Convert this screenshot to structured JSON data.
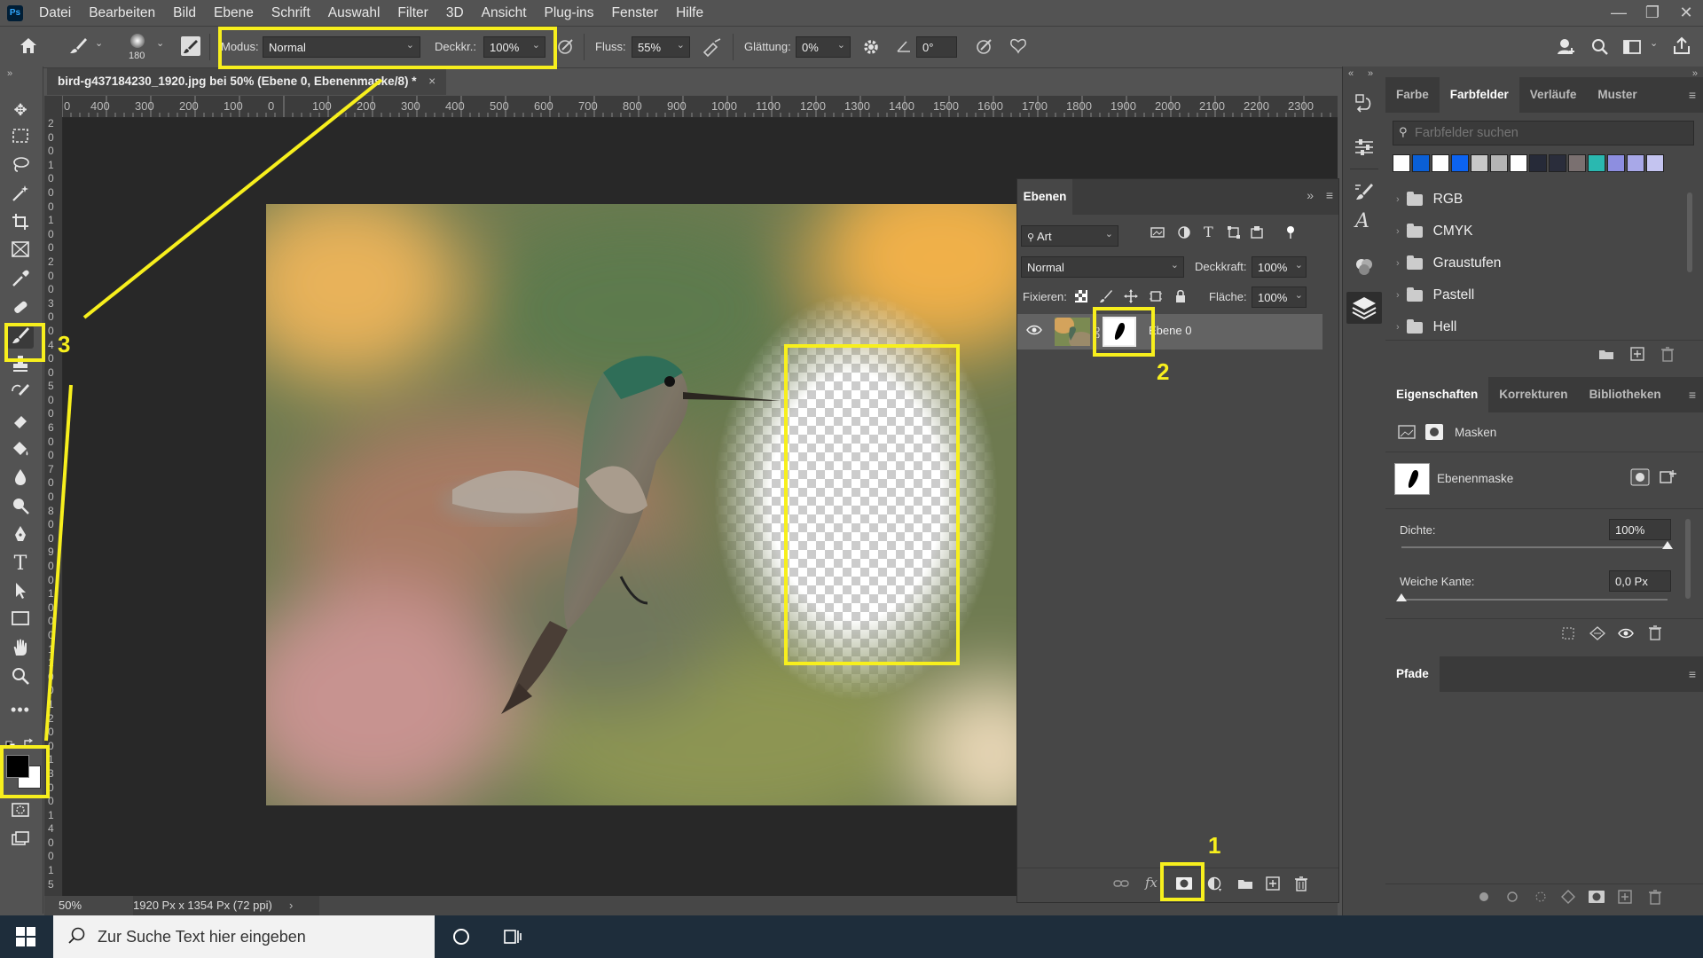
{
  "app": {
    "logo": "Ps"
  },
  "menu": [
    "Datei",
    "Bearbeiten",
    "Bild",
    "Ebene",
    "Schrift",
    "Auswahl",
    "Filter",
    "3D",
    "Ansicht",
    "Plug-ins",
    "Fenster",
    "Hilfe"
  ],
  "window_controls": {
    "minimize": "—",
    "restore": "❐",
    "close": "✕"
  },
  "options": {
    "brush_size": "180",
    "mode_label": "Modus:",
    "mode_value": "Normal",
    "opacity_label": "Deckkr.:",
    "opacity_value": "100%",
    "flow_label": "Fluss:",
    "flow_value": "55%",
    "smoothing_label": "Glättung:",
    "smoothing_value": "0%",
    "angle_value": "0°"
  },
  "document": {
    "tab_title": "bird-g437184230_1920.jpg bei 50% (Ebene 0, Ebenenmaske/8) *",
    "close": "×",
    "zoom": "50%",
    "size_info": "1920 Px x 1354 Px (72 ppi)",
    "ruler_h": [
      "0",
      "400",
      "300",
      "200",
      "100",
      "0",
      "100",
      "200",
      "300",
      "400",
      "500",
      "600",
      "700",
      "800",
      "900",
      "1000",
      "1100",
      "1200",
      "1300",
      "1400",
      "1500",
      "1600",
      "1700",
      "1800",
      "1900",
      "2000",
      "2100",
      "2200",
      "2300"
    ],
    "ruler_v": [
      "2",
      "0",
      "0",
      "1",
      "0",
      "0",
      "0",
      "1",
      "0",
      "0",
      "2",
      "0",
      "0",
      "3",
      "0",
      "0",
      "4",
      "0",
      "0",
      "5",
      "0",
      "0",
      "6",
      "0",
      "0",
      "7",
      "0",
      "0",
      "8",
      "0",
      "0",
      "9",
      "0",
      "0",
      "1",
      "0",
      "0",
      "0",
      "1",
      "1",
      "0",
      "0",
      "1",
      "2",
      "0",
      "0",
      "1",
      "3",
      "0",
      "0",
      "1",
      "4",
      "0",
      "0",
      "1",
      "5"
    ]
  },
  "layers_panel": {
    "title": "Ebenen",
    "filter_kind": "Art",
    "blend_mode": "Normal",
    "opacity_label": "Deckkraft:",
    "opacity_value": "100%",
    "lock_label": "Fixieren:",
    "fill_label": "Fläche:",
    "fill_value": "100%",
    "layers": [
      {
        "name": "Ebene 0"
      }
    ]
  },
  "swatches_panel": {
    "tabs": [
      "Farbe",
      "Farbfelder",
      "Verläufe",
      "Muster"
    ],
    "active_tab": "Farbfelder",
    "search_placeholder": "Farbfelder suchen",
    "swatch_colors": [
      "#ffffff",
      "#0a5fd6",
      "#ffffff",
      "#0c63f0",
      "#c8c8c8",
      "#b4b4b4",
      "#ffffff",
      "#262a38",
      "#2a2d3b",
      "#7a7070",
      "#2ab8b0",
      "#8d8ee0",
      "#a8a8e8",
      "#c4c4f0"
    ],
    "groups": [
      "RGB",
      "CMYK",
      "Graustufen",
      "Pastell",
      "Hell"
    ]
  },
  "properties_panel": {
    "tabs": [
      "Eigenschaften",
      "Korrekturen",
      "Bibliotheken"
    ],
    "active_tab": "Eigenschaften",
    "masks_label": "Masken",
    "mask_name": "Ebenenmaske",
    "density_label": "Dichte:",
    "density_value": "100%",
    "density_level": 1.0,
    "feather_label": "Weiche Kante:",
    "feather_value": "0,0 Px",
    "feather_level": 0.0
  },
  "paths_panel": {
    "title": "Pfade"
  },
  "taskbar": {
    "search_placeholder": "Zur Suche Text hier eingeben"
  },
  "annotations": {
    "n1": "1",
    "n2": "2",
    "n3": "3"
  },
  "colors": {
    "highlight": "#f7ef1d",
    "panel_bg": "#474747",
    "ui_bg": "#535353",
    "canvas_bg": "#282828"
  }
}
